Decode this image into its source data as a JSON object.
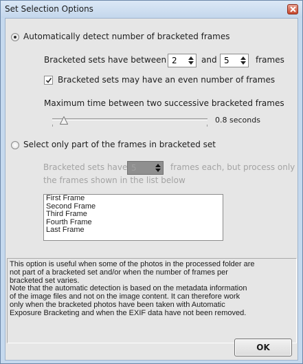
{
  "window": {
    "title": "Set Selection Options"
  },
  "auto": {
    "radio_label": "Automatically detect number of bracketed frames",
    "selected": true,
    "between_label": "Bracketed sets have between",
    "min_value": "2",
    "and_label": "and",
    "max_value": "5",
    "frames_label": "frames",
    "even_checkbox_label": "Bracketed sets may have an even number of frames",
    "even_checked": true,
    "max_time_label": "Maximum time between two successive bracketed frames",
    "max_time_value": "0.8 seconds"
  },
  "manual": {
    "radio_label": "Select only part of the frames in bracketed set",
    "selected": false,
    "have_label": "Bracketed sets have",
    "frames_value": "5",
    "process_label_line1": "frames each, but process only",
    "process_label_line2": "the frames shown in the list below",
    "frames_list": [
      "First Frame",
      "Second Frame",
      "Third Frame",
      "Fourth Frame",
      "Last Frame"
    ]
  },
  "info": {
    "lines": [
      "This option is useful when some of the photos in the processed folder are",
      "not part of a bracketed set and/or when the number of frames per",
      "bracketed set varies.",
      "Note that the automatic detection is based on the metadata information",
      "of the image files and not on the image content.  It can therefore work",
      "only when the bracketed photos have been taken with Automatic",
      "Exposure Bracketing and when the EXIF data have not been removed."
    ]
  },
  "buttons": {
    "ok_label": "OK"
  },
  "colors": {
    "frame": "#c5d9ee",
    "client": "#e6e6e6",
    "disabled_text": "#a3a3a3",
    "close": "#c7462c"
  },
  "icons": {
    "close": "close-icon",
    "spin": "spin-arrows-icon",
    "check": "checkmark-icon"
  }
}
